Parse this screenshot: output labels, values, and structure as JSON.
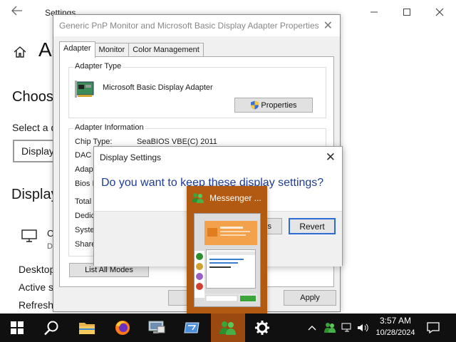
{
  "settings": {
    "title": "Settings",
    "heading": "Ac",
    "choose": "Choos",
    "select_label": "Select a d",
    "select_value": "Display",
    "display_heading": "Display",
    "monitor_label": "C",
    "monitor_sub": "D",
    "links": [
      "Desktop",
      "Active s",
      "Refresh"
    ],
    "window_controls": [
      "minimize-icon",
      "maximize-icon",
      "close-icon"
    ]
  },
  "properties": {
    "title": "Generic PnP Monitor and Microsoft Basic Display Adapter Properties",
    "tabs": [
      "Adapter",
      "Monitor",
      "Color Management"
    ],
    "active_tab": "Adapter",
    "adapter_type_label": "Adapter Type",
    "adapter_name": "Microsoft Basic Display Adapter",
    "properties_button": "Properties",
    "adapter_info_label": "Adapter Information",
    "info_rows": [
      {
        "label": "Chip Type:",
        "value": "SeaBIOS VBE(C) 2011"
      },
      {
        "label": "DAC T",
        "value": ""
      },
      {
        "label": "Adapt",
        "value": ""
      },
      {
        "label": "Bios I",
        "value": ""
      },
      {
        "label": "Total",
        "value": ""
      },
      {
        "label": "Dedic",
        "value": ""
      },
      {
        "label": "Syste",
        "value": ""
      },
      {
        "label": "Share",
        "value": ""
      }
    ],
    "list_modes_button": "List All Modes",
    "apply_button": "Apply"
  },
  "display_dialog": {
    "title": "Display Settings",
    "question": "Do you want to keep these display settings?",
    "keep_button": "s",
    "revert_button": "Revert"
  },
  "messenger": {
    "title": "Messenger ..."
  },
  "taskbar": {
    "time": "3:57 AM",
    "date": "10/28/2024",
    "apps": [
      "start",
      "search",
      "file-explorer",
      "firefox",
      "remote-desktop",
      "app-window",
      "messenger",
      "settings"
    ],
    "active_app": "messenger",
    "colors": {
      "taskbar_bg": "#101010",
      "active_bg": "#9a4a10"
    }
  }
}
